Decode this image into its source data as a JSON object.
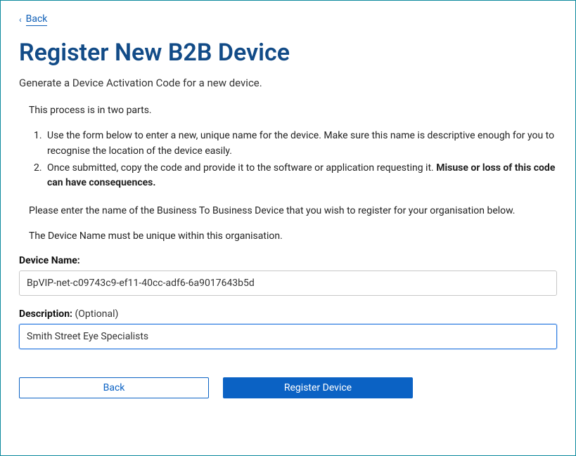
{
  "backLink": {
    "label": "Back"
  },
  "title": "Register New B2B Device",
  "subtitle": "Generate a Device Activation Code for a new device.",
  "intro": "This process is in two parts.",
  "steps": {
    "one": "Use the form below to enter a new, unique name for the device. Make sure this name is descriptive enough for you to recognise the location of the device easily.",
    "twoPrefix": "Once submitted, copy the code and provide it to the software or application requesting it. ",
    "twoBold": "Misuse or loss of this code can have consequences."
  },
  "instruction1": "Please enter the name of the Business To Business Device that you wish to register for your organisation below.",
  "instruction2": "The Device Name must be unique within this organisation.",
  "form": {
    "deviceNameLabel": "Device Name:",
    "deviceNameValue": "BpVIP-net-c09743c9-ef11-40cc-adf6-6a9017643b5d",
    "descriptionLabel": "Description:",
    "descriptionOptional": " (Optional)",
    "descriptionValue": "Smith Street Eye Specialists"
  },
  "buttons": {
    "back": "Back",
    "register": "Register Device"
  }
}
